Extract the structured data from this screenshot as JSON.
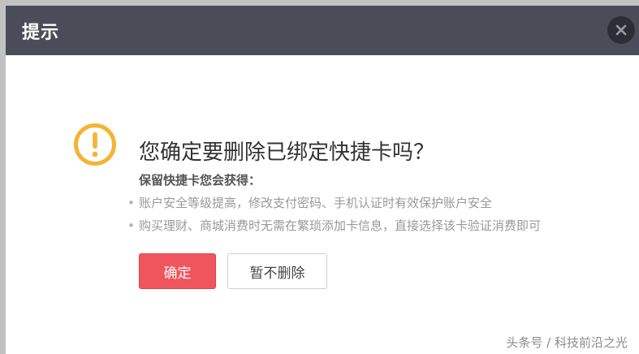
{
  "dialog": {
    "title": "提示",
    "close_icon": "close-icon",
    "message": {
      "icon": "warning-icon",
      "icon_color": "#f5b335",
      "question": "您确定要删除已绑定快捷卡吗？",
      "keep_title": "保留快捷卡您会获得：",
      "benefits": [
        "账户安全等级提高，修改支付密码、手机认证时有效保护账户安全",
        "购买理财、商城消费时无需在繁琐添加卡信息，直接选择该卡验证消费即可"
      ]
    },
    "buttons": {
      "confirm_label": "确定",
      "cancel_label": "暂不删除",
      "confirm_color": "#f0545c"
    }
  },
  "watermark": "头条号 / 科技前沿之光"
}
